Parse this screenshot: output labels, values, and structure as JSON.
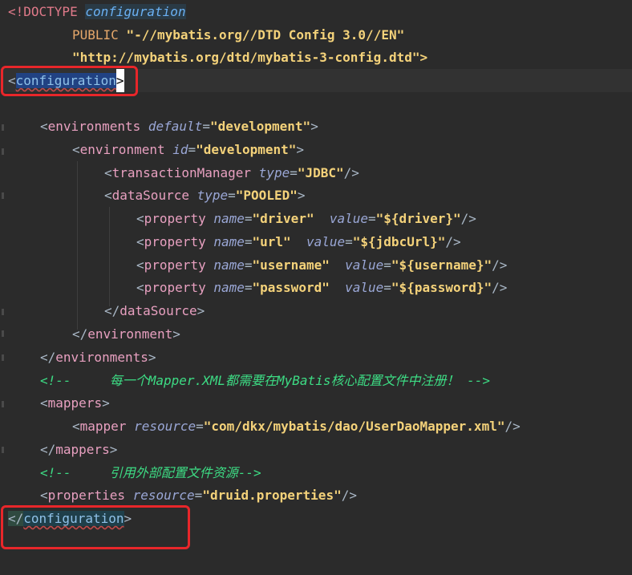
{
  "doctype": {
    "keyword": "<!DOCTYPE",
    "root": "configuration",
    "public_kw": "PUBLIC",
    "public_id": "\"-//mybatis.org//DTD Config 3.0//EN\"",
    "system_url": "\"http://mybatis.org/dtd/mybatis-3-config.dtd\">"
  },
  "tags": {
    "configuration": "configuration",
    "environments": "environments",
    "environment": "environment",
    "transactionManager": "transactionManager",
    "dataSource": "dataSource",
    "property": "property",
    "mappers": "mappers",
    "mapper": "mapper",
    "properties": "properties"
  },
  "attrs": {
    "default": "default",
    "id": "id",
    "type": "type",
    "name": "name",
    "value": "value",
    "resource": "resource"
  },
  "values": {
    "environments_default": "\"development\"",
    "environment_id": "\"development\"",
    "tm_type": "\"JDBC\"",
    "ds_type": "\"POOLED\"",
    "p1_name": "\"driver\"",
    "p1_value": "\"${driver}\"",
    "p2_name": "\"url\"",
    "p2_value": "\"${jdbcUrl}\"",
    "p3_name": "\"username\"",
    "p3_value": "\"${username}\"",
    "p4_name": "\"password\"",
    "p4_value": "\"${password}\"",
    "mapper_resource": "\"com/dkx/mybatis/dao/UserDaoMapper.xml\"",
    "properties_resource": "\"druid.properties\""
  },
  "comments": {
    "mapper_note": "<!--     每一个Mapper.XML都需要在MyBatis核心配置文件中注册！ -->",
    "external_note": "<!--     引用外部配置文件资源-->"
  }
}
